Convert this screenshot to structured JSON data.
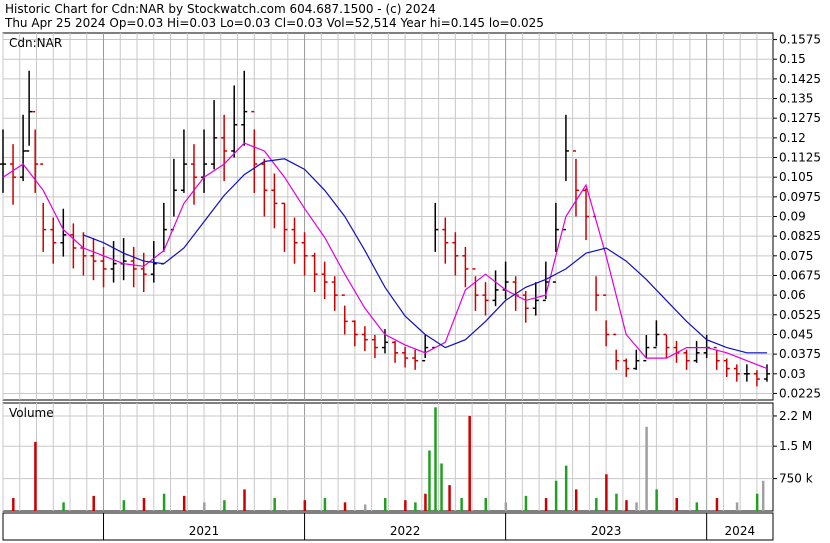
{
  "header": {
    "line1": "Historic Chart for Cdn:NAR by Stockwatch.com 604.687.1500 - (c) 2024",
    "line2": "Thu Apr 25 2024  Op=0.03  Hi=0.03  Lo=0.03  Cl=0.03  Vol=52,514  Year hi=0.145  lo=0.025"
  },
  "colors": {
    "up": "#000000",
    "down": "#cc0000",
    "ma_short": "#e000e0",
    "ma_long": "#1010c0",
    "vol_up": "#20a020",
    "vol_down": "#cc0000",
    "vol_flat": "#a0a0a0",
    "grid": "#c8c8c8"
  },
  "chart_data": [
    {
      "type": "line",
      "panel": "price",
      "title": "Cdn:NAR",
      "ylim": [
        0.02,
        0.16
      ],
      "y_ticks": [
        "0.1575",
        "0.15",
        "0.1425",
        "0.135",
        "0.1275",
        "0.12",
        "0.1125",
        "0.105",
        "0.0975",
        "0.09",
        "0.0825",
        "0.075",
        "0.0675",
        "0.06",
        "0.0525",
        "0.045",
        "0.0375",
        "0.03",
        "0.0225"
      ],
      "x_labels": [
        "2021",
        "2022",
        "2023",
        "2024"
      ],
      "series": [
        {
          "x": [
            2020.5,
            2020.55,
            2020.6,
            2020.63,
            2020.66,
            2020.7,
            2020.75,
            2020.8,
            2020.85,
            2020.9,
            2020.95,
            2021.0,
            2021.05,
            2021.1,
            2021.15,
            2021.2,
            2021.25,
            2021.3,
            2021.35,
            2021.4,
            2021.45,
            2021.5,
            2021.55,
            2021.6,
            2021.65,
            2021.7,
            2021.75,
            2021.8,
            2021.85,
            2021.9,
            2021.95,
            2022.0,
            2022.05,
            2022.1,
            2022.15,
            2022.2,
            2022.25,
            2022.3,
            2022.35,
            2022.4,
            2022.45,
            2022.5,
            2022.55,
            2022.6,
            2022.65,
            2022.7,
            2022.75,
            2022.8,
            2022.85,
            2022.9,
            2022.95,
            2023.0,
            2023.05,
            2023.1,
            2023.15,
            2023.2,
            2023.25,
            2023.3,
            2023.35,
            2023.4,
            2023.45,
            2023.5,
            2023.55,
            2023.6,
            2023.65,
            2023.7,
            2023.75,
            2023.8,
            2023.85,
            2023.9,
            2023.95,
            2024.0,
            2024.05,
            2024.1,
            2024.15,
            2024.2,
            2024.25,
            2024.3
          ],
          "y": [
            0.11,
            0.105,
            0.115,
            0.13,
            0.11,
            0.085,
            0.08,
            0.083,
            0.078,
            0.075,
            0.073,
            0.07,
            0.072,
            0.073,
            0.07,
            0.068,
            0.072,
            0.085,
            0.1,
            0.11,
            0.105,
            0.11,
            0.12,
            0.115,
            0.125,
            0.13,
            0.11,
            0.1,
            0.095,
            0.085,
            0.08,
            0.075,
            0.068,
            0.065,
            0.06,
            0.05,
            0.045,
            0.043,
            0.04,
            0.042,
            0.038,
            0.036,
            0.035,
            0.04,
            0.085,
            0.08,
            0.075,
            0.07,
            0.06,
            0.058,
            0.062,
            0.065,
            0.06,
            0.055,
            0.058,
            0.065,
            0.085,
            0.115,
            0.1,
            0.09,
            0.06,
            0.045,
            0.035,
            0.032,
            0.035,
            0.04,
            0.045,
            0.04,
            0.038,
            0.035,
            0.038,
            0.04,
            0.035,
            0.032,
            0.03,
            0.03,
            0.028,
            0.03
          ]
        },
        {
          "name": "",
          "style": "short-average",
          "x": [
            2020.5,
            2020.6,
            2020.7,
            2020.8,
            2020.9,
            2021.0,
            2021.1,
            2021.2,
            2021.3,
            2021.4,
            2021.5,
            2021.6,
            2021.7,
            2021.8,
            2021.9,
            2022.0,
            2022.1,
            2022.2,
            2022.3,
            2022.4,
            2022.5,
            2022.6,
            2022.7,
            2022.8,
            2022.9,
            2023.0,
            2023.1,
            2023.2,
            2023.3,
            2023.4,
            2023.5,
            2023.6,
            2023.7,
            2023.8,
            2023.9,
            2024.0,
            2024.1,
            2024.2,
            2024.3
          ],
          "y": [
            0.105,
            0.11,
            0.1,
            0.085,
            0.078,
            0.075,
            0.072,
            0.071,
            0.077,
            0.095,
            0.105,
            0.11,
            0.118,
            0.115,
            0.105,
            0.093,
            0.082,
            0.068,
            0.055,
            0.045,
            0.041,
            0.038,
            0.042,
            0.062,
            0.068,
            0.062,
            0.058,
            0.06,
            0.09,
            0.102,
            0.075,
            0.045,
            0.036,
            0.036,
            0.04,
            0.04,
            0.038,
            0.035,
            0.032
          ]
        },
        {
          "name": "",
          "style": "long-average",
          "x": [
            2020.9,
            2021.0,
            2021.1,
            2021.2,
            2021.3,
            2021.4,
            2021.5,
            2021.6,
            2021.7,
            2021.8,
            2021.9,
            2022.0,
            2022.1,
            2022.2,
            2022.3,
            2022.4,
            2022.5,
            2022.6,
            2022.7,
            2022.8,
            2022.9,
            2023.0,
            2023.1,
            2023.2,
            2023.3,
            2023.4,
            2023.5,
            2023.6,
            2023.7,
            2023.8,
            2023.9,
            2024.0,
            2024.1,
            2024.2,
            2024.3
          ],
          "y": [
            0.083,
            0.08,
            0.076,
            0.073,
            0.072,
            0.078,
            0.088,
            0.098,
            0.106,
            0.111,
            0.112,
            0.108,
            0.1,
            0.09,
            0.077,
            0.063,
            0.052,
            0.045,
            0.04,
            0.043,
            0.05,
            0.058,
            0.063,
            0.066,
            0.07,
            0.076,
            0.078,
            0.073,
            0.066,
            0.058,
            0.05,
            0.043,
            0.04,
            0.038,
            0.038
          ]
        }
      ]
    },
    {
      "type": "bar",
      "panel": "volume",
      "title": "Volume",
      "ylim": [
        0,
        2500000
      ],
      "y_ticks": [
        "2.2 M",
        "1.5 M",
        "750 k"
      ],
      "x": [
        2020.55,
        2020.66,
        2020.8,
        2020.95,
        2021.1,
        2021.2,
        2021.3,
        2021.4,
        2021.5,
        2021.6,
        2021.7,
        2021.85,
        2022.0,
        2022.1,
        2022.2,
        2022.3,
        2022.4,
        2022.5,
        2022.55,
        2022.6,
        2022.62,
        2022.65,
        2022.68,
        2022.72,
        2022.78,
        2022.82,
        2022.9,
        2023.0,
        2023.1,
        2023.2,
        2023.25,
        2023.3,
        2023.35,
        2023.45,
        2023.5,
        2023.55,
        2023.6,
        2023.65,
        2023.7,
        2023.75,
        2023.85,
        2023.95,
        2024.05,
        2024.15,
        2024.25,
        2024.28
      ],
      "values": [
        300000,
        1600000,
        200000,
        350000,
        250000,
        300000,
        400000,
        350000,
        200000,
        250000,
        500000,
        300000,
        250000,
        300000,
        200000,
        150000,
        300000,
        250000,
        200000,
        400000,
        1400000,
        2400000,
        1100000,
        600000,
        300000,
        2200000,
        300000,
        200000,
        350000,
        300000,
        700000,
        1050000,
        500000,
        300000,
        850000,
        400000,
        250000,
        200000,
        1950000,
        500000,
        300000,
        200000,
        300000,
        200000,
        400000,
        700000
      ],
      "directions": [
        "down",
        "down",
        "up",
        "down",
        "up",
        "down",
        "up",
        "down",
        "flat",
        "up",
        "down",
        "up",
        "down",
        "up",
        "down",
        "flat",
        "up",
        "down",
        "up",
        "down",
        "up",
        "up",
        "up",
        "down",
        "up",
        "down",
        "up",
        "flat",
        "up",
        "down",
        "up",
        "up",
        "down",
        "up",
        "down",
        "up",
        "down",
        "flat",
        "flat",
        "up",
        "down",
        "up",
        "down",
        "flat",
        "up",
        "flat"
      ]
    }
  ]
}
